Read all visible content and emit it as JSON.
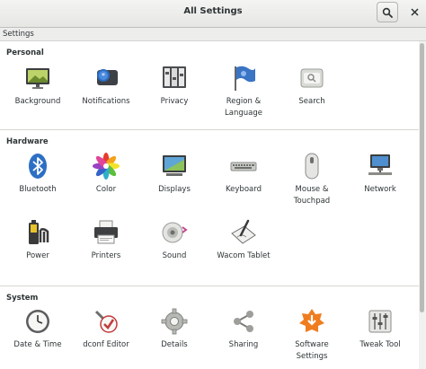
{
  "window": {
    "title": "All Settings"
  },
  "header": {
    "search_icon": "magnifier-icon",
    "close_icon": "close-icon"
  },
  "breadcrumb": {
    "label": "Settings"
  },
  "sections": {
    "personal": {
      "title": "Personal",
      "items": [
        {
          "label": "Background",
          "icon": "background-icon"
        },
        {
          "label": "Notifications",
          "icon": "notifications-icon"
        },
        {
          "label": "Privacy",
          "icon": "privacy-icon"
        },
        {
          "label": "Region &\nLanguage",
          "icon": "region-flag-icon"
        },
        {
          "label": "Search",
          "icon": "search-settings-icon"
        }
      ]
    },
    "hardware": {
      "title": "Hardware",
      "items": [
        {
          "label": "Bluetooth",
          "icon": "bluetooth-icon"
        },
        {
          "label": "Color",
          "icon": "color-icon"
        },
        {
          "label": "Displays",
          "icon": "displays-icon"
        },
        {
          "label": "Keyboard",
          "icon": "keyboard-icon"
        },
        {
          "label": "Mouse &\nTouchpad",
          "icon": "mouse-icon"
        },
        {
          "label": "Network",
          "icon": "network-icon"
        },
        {
          "label": "Power",
          "icon": "power-icon"
        },
        {
          "label": "Printers",
          "icon": "printer-icon"
        },
        {
          "label": "Sound",
          "icon": "sound-icon"
        },
        {
          "label": "Wacom Tablet",
          "icon": "wacom-tablet-icon"
        }
      ]
    },
    "system": {
      "title": "System",
      "items": [
        {
          "label": "Date & Time",
          "icon": "clock-icon"
        },
        {
          "label": "dconf Editor",
          "icon": "dconf-editor-icon"
        },
        {
          "label": "Details",
          "icon": "gear-details-icon"
        },
        {
          "label": "Sharing",
          "icon": "sharing-icon"
        },
        {
          "label": "Software\nSettings",
          "icon": "software-settings-icon"
        },
        {
          "label": "Tweak Tool",
          "icon": "tweak-tool-icon"
        }
      ]
    }
  }
}
